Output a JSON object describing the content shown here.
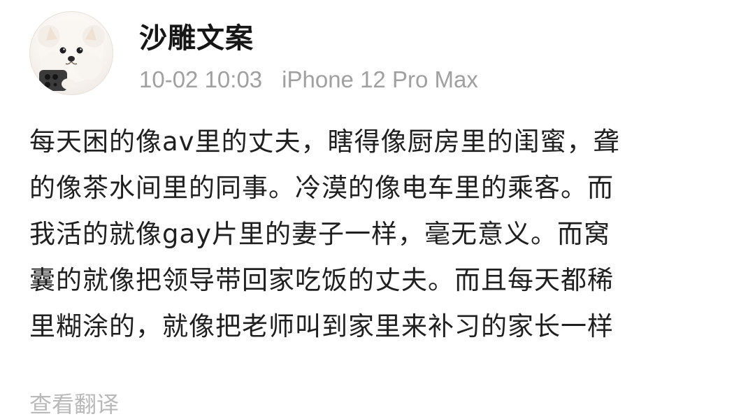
{
  "post": {
    "author": {
      "name": "沙雕文案",
      "avatar_icon": "pomeranian-dog-avatar"
    },
    "timestamp": "10-02 10:03",
    "device": "iPhone 12 Pro Max",
    "body_lines": [
      "每天困的像av里的丈夫，瞎得像厨房里的闺蜜，聋",
      "的像茶水间里的同事。冷漠的像电车里的乘客。而",
      "我活的就像gay片里的妻子一样，毫无意义。而窝",
      "囊的就像把领导带回家吃饭的丈夫。而且每天都稀",
      "里糊涂的，就像把老师叫到家里来补习的家长一样"
    ],
    "translate_link": "查看翻译"
  },
  "colors": {
    "text": "#1f1f1f",
    "meta": "#a0a0a0",
    "link": "#b9b9b9",
    "background": "#ffffff"
  }
}
